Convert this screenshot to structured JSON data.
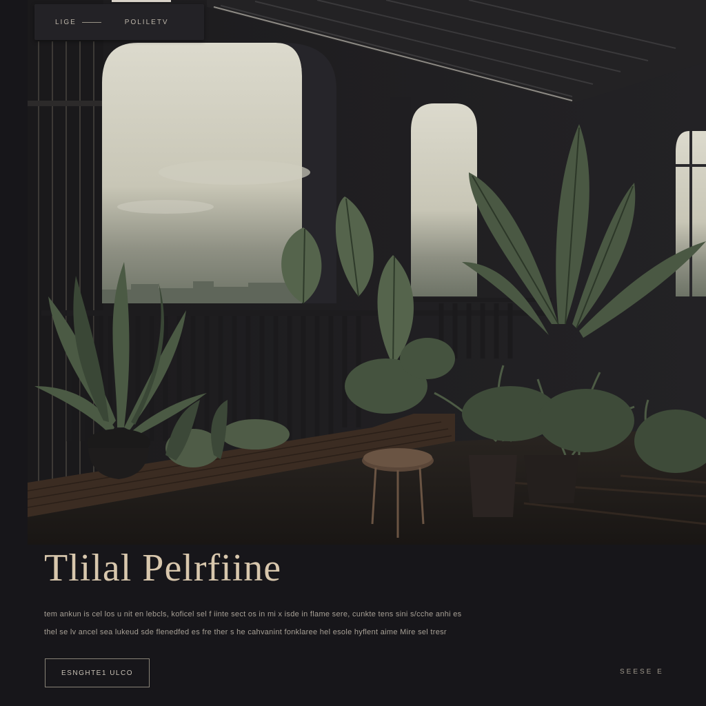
{
  "nav": {
    "item_1": "LIGE",
    "item_2": "POLILETV"
  },
  "hero": {
    "title": "Tlilal Pelrfiine",
    "description_lines": [
      "tem ankun is cel los u nit en lebcls, koficel sel f iinte sect os in mi x isde in flame sere, cunkte tens sini s/cche anhi es",
      "thel se lv ancel sea lukeud sde flenedfed es fre ther s he cahvanint fonklaree hel esole hyflent aime Mire sel tresr"
    ],
    "cta_label": "ESNGHTE1 ULCO"
  },
  "footer": {
    "link_label": "SEESE E"
  },
  "colors": {
    "background": "#17161a",
    "title": "#d8c7ad",
    "body_text": "#a7a096",
    "plant_green": "#4d5b44"
  },
  "icons": []
}
